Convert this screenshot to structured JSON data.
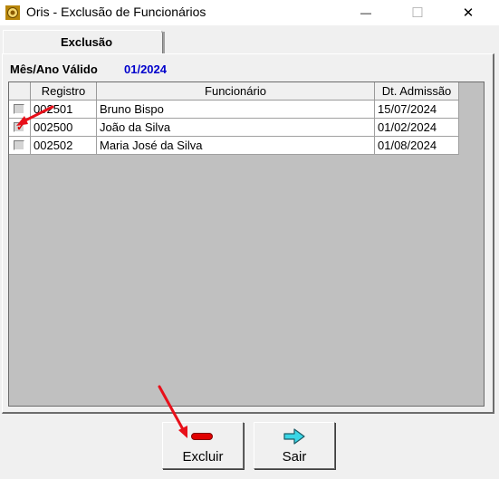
{
  "window": {
    "title": "Oris - Exclusão de Funcionários",
    "minimize_glyph": "—",
    "maximize_glyph": "☐",
    "close_glyph": "✕"
  },
  "tab": {
    "label": "Exclusão"
  },
  "period": {
    "label": "Mês/Ano Válido",
    "value": "01/2024"
  },
  "table": {
    "columns": [
      "Registro",
      "Funcionário",
      "Dt. Admissão"
    ],
    "rows": [
      {
        "checked": false,
        "registro": "002501",
        "funcionario": "Bruno Bispo",
        "admissao": "15/07/2024"
      },
      {
        "checked": true,
        "registro": "002500",
        "funcionario": "João da Silva",
        "admissao": "01/02/2024"
      },
      {
        "checked": false,
        "registro": "002502",
        "funcionario": "Maria José da Silva",
        "admissao": "01/08/2024"
      }
    ]
  },
  "buttons": {
    "excluir": "Excluir",
    "sair": "Sair"
  },
  "colors": {
    "period_value": "#0000cc",
    "annotation": "#e8101a",
    "grid_empty": "#c0c0c0"
  },
  "icons": {
    "app": "oris-app-icon",
    "excluir": "minus-icon",
    "sair": "arrow-right-icon"
  }
}
